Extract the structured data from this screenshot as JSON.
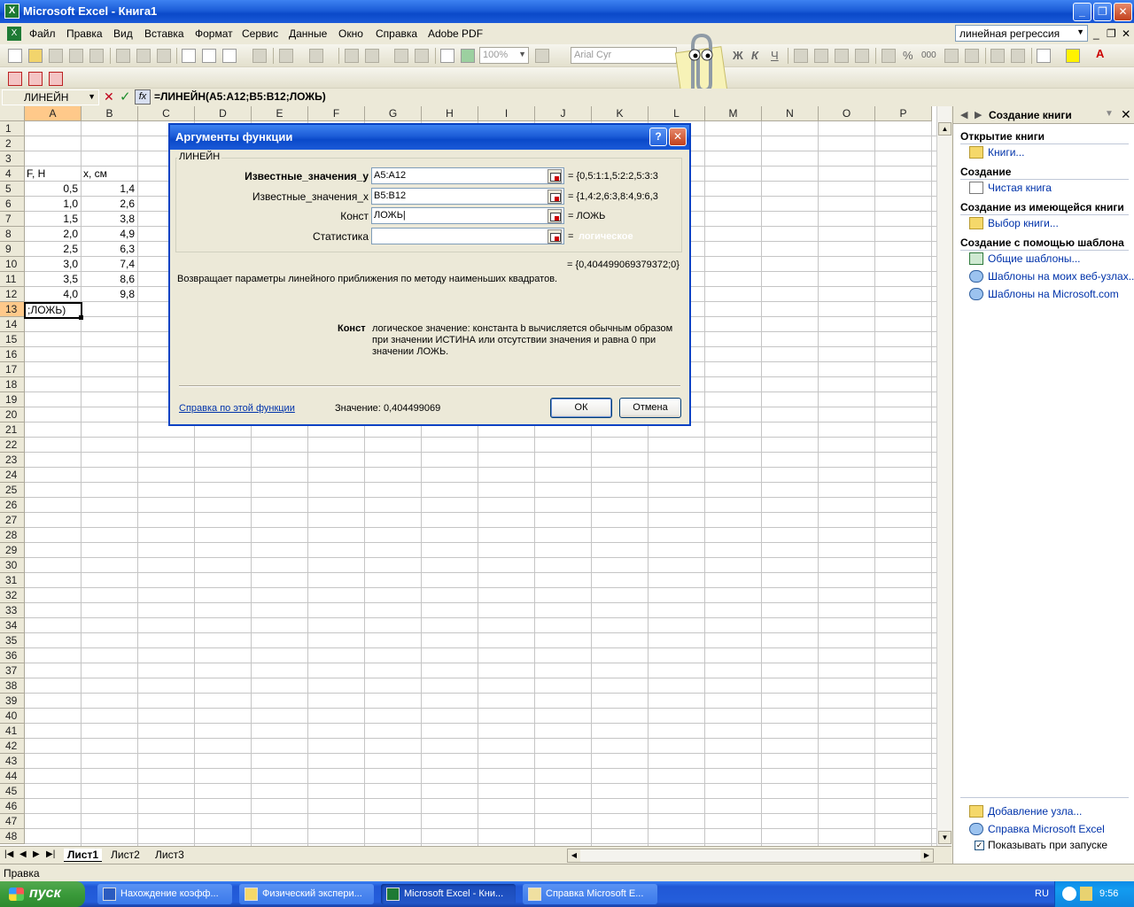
{
  "window": {
    "title": "Microsoft Excel - Книга1",
    "controls": [
      "_",
      "❐",
      "✕"
    ]
  },
  "menubar": {
    "items": [
      "Файл",
      "Правка",
      "Вид",
      "Вставка",
      "Формат",
      "Сервис",
      "Данные",
      "Окно",
      "Справка",
      "Adobe PDF"
    ],
    "help_box": "линейная регрессия",
    "doc_controls": [
      "_",
      "❐",
      "✕"
    ]
  },
  "toolbar": {
    "zoom": "100%",
    "font": "Arial Cyr"
  },
  "formula_bar": {
    "name_box": "ЛИНЕЙН",
    "formula": "=ЛИНЕЙН(A5:A12;B5:B12;ЛОЖЬ)"
  },
  "grid": {
    "columns": [
      "A",
      "B",
      "C",
      "D",
      "E",
      "F",
      "G",
      "H",
      "I",
      "J",
      "K",
      "L",
      "M",
      "N",
      "O",
      "P"
    ],
    "rows": [
      "1",
      "2",
      "3",
      "4",
      "5",
      "6",
      "7",
      "8",
      "9",
      "10",
      "11",
      "12",
      "13",
      "14",
      "15",
      "16",
      "17",
      "18",
      "19",
      "20",
      "21",
      "22",
      "23",
      "24",
      "25",
      "26",
      "27",
      "28",
      "29",
      "30",
      "31",
      "32",
      "33",
      "34",
      "35",
      "36",
      "37",
      "38",
      "39",
      "40",
      "41",
      "42",
      "43",
      "44",
      "45",
      "46",
      "47",
      "48"
    ],
    "header_a": "F, H",
    "header_b": "x, см",
    "col_a": [
      "0,5",
      "1,0",
      "1,5",
      "2,0",
      "2,5",
      "3,0",
      "3,5",
      "4,0"
    ],
    "col_b": [
      "1,4",
      "2,6",
      "3,8",
      "4,9",
      "6,3",
      "7,4",
      "8,6",
      "9,8"
    ],
    "active_cell_text": ";ЛОЖЬ)"
  },
  "sheets": {
    "nav": [
      "|◀",
      "◀",
      "▶",
      "▶|"
    ],
    "tabs": [
      "Лист1",
      "Лист2",
      "Лист3"
    ]
  },
  "statusbar": {
    "text": "Правка"
  },
  "taskpane": {
    "title": "Создание книги",
    "section_open": "Открытие книги",
    "link_books": "Книги...",
    "section_create": "Создание",
    "link_blank": "Чистая книга",
    "section_from_existing": "Создание из имеющейся книги",
    "link_choose": "Выбор книги...",
    "section_template": "Создание с помощью шаблона",
    "link_general_templates": "Общие шаблоны...",
    "link_web_templates": "Шаблоны на моих веб-узлах...",
    "link_ms_templates": "Шаблоны на Microsoft.com",
    "link_add_node": "Добавление узла...",
    "link_help": "Справка Microsoft Excel",
    "checkbox_label": "Показывать при запуске"
  },
  "dialog": {
    "title": "Аргументы функции",
    "help_btn": "?",
    "close_btn": "✕",
    "function_name": "ЛИНЕЙН",
    "args": [
      {
        "label": "Известные_значения_y",
        "value": "A5:A12",
        "result": "= {0,5:1:1,5:2:2,5:3:3"
      },
      {
        "label": "Известные_значения_x",
        "value": "B5:B12",
        "result": "= {1,4:2,6:3,8:4,9:6,3"
      },
      {
        "label": "Конст",
        "value": "ЛОЖЬ|",
        "result": "= ЛОЖЬ"
      },
      {
        "label": "Статистика",
        "value": "",
        "result_eq": "=",
        "result": "логическое"
      }
    ],
    "total": "= {0,404499069379372;0}",
    "description": "Возвращает параметры линейного приближения по методу наименьших квадратов.",
    "arg_name": "Конст",
    "arg_description": "логическое значение: константа b вычисляется обычным образом при значении ИСТИНА или отсутствии значения и равна 0 при значении ЛОЖЬ.",
    "help_link": "Справка по этой функции",
    "value_label": "Значение:",
    "value": "0,404499069",
    "ok": "ОК",
    "cancel": "Отмена"
  },
  "taskbar": {
    "start": "пуск",
    "tasks": [
      "Нахождение коэфф...",
      "Физический экспери...",
      "Microsoft Excel - Кни...",
      "Справка Microsoft E..."
    ],
    "lang": "RU",
    "clock": "9:56"
  }
}
